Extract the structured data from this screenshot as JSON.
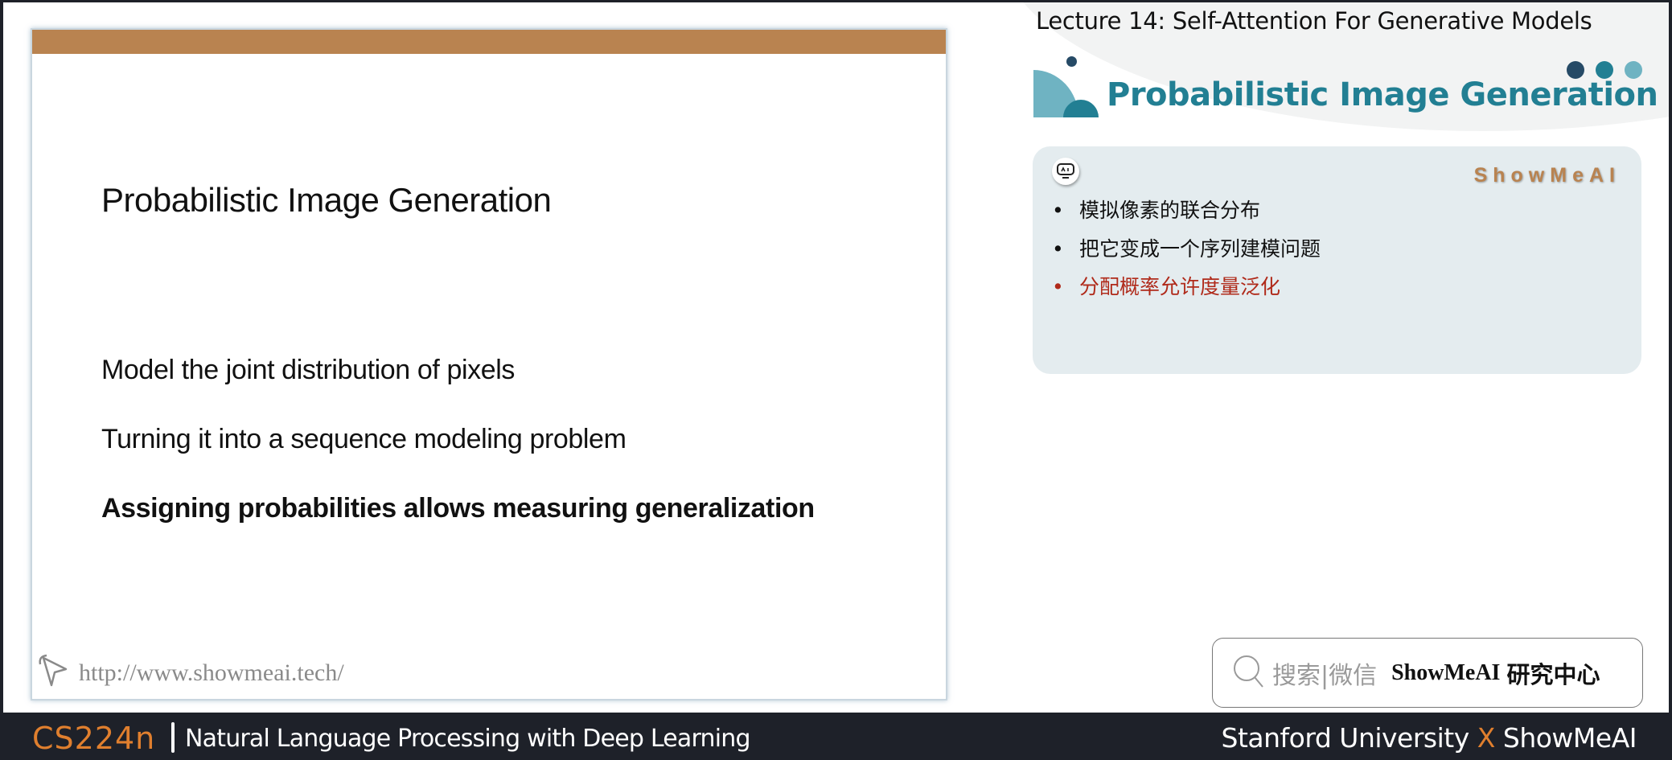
{
  "header": {
    "lecture_title": "Lecture 14:  Self-Attention For Generative Models",
    "section_title": "Probabilistic Image Generation",
    "dot_colors": [
      "#264a66",
      "#227f93",
      "#6fb3c2"
    ]
  },
  "slide": {
    "title": "Probabilistic Image Generation",
    "lines": [
      "Model the joint distribution of pixels",
      "Turning it into a sequence modeling problem",
      "Assigning probabilities allows measuring generalization"
    ],
    "url": "http://www.showmeai.tech/",
    "accent_bar_color": "#b98350"
  },
  "card": {
    "watermark": "ShowMeAI",
    "bullet": "•",
    "items": [
      {
        "text": "模拟像素的联合分布"
      },
      {
        "text": "把它变成一个序列建模问题"
      },
      {
        "text": "分配概率允许度量泛化",
        "highlight": true
      }
    ],
    "highlight_color": "#b02a1a"
  },
  "search": {
    "label": "搜索|微信",
    "brand": "ShowMeAI",
    "brand_suffix": "研究中心"
  },
  "footer": {
    "course_code": "CS224n",
    "course_name": "Natural Language Processing with Deep Learning",
    "credit_left": "Stanford University",
    "credit_x": "X",
    "credit_right": "ShowMeAI"
  }
}
